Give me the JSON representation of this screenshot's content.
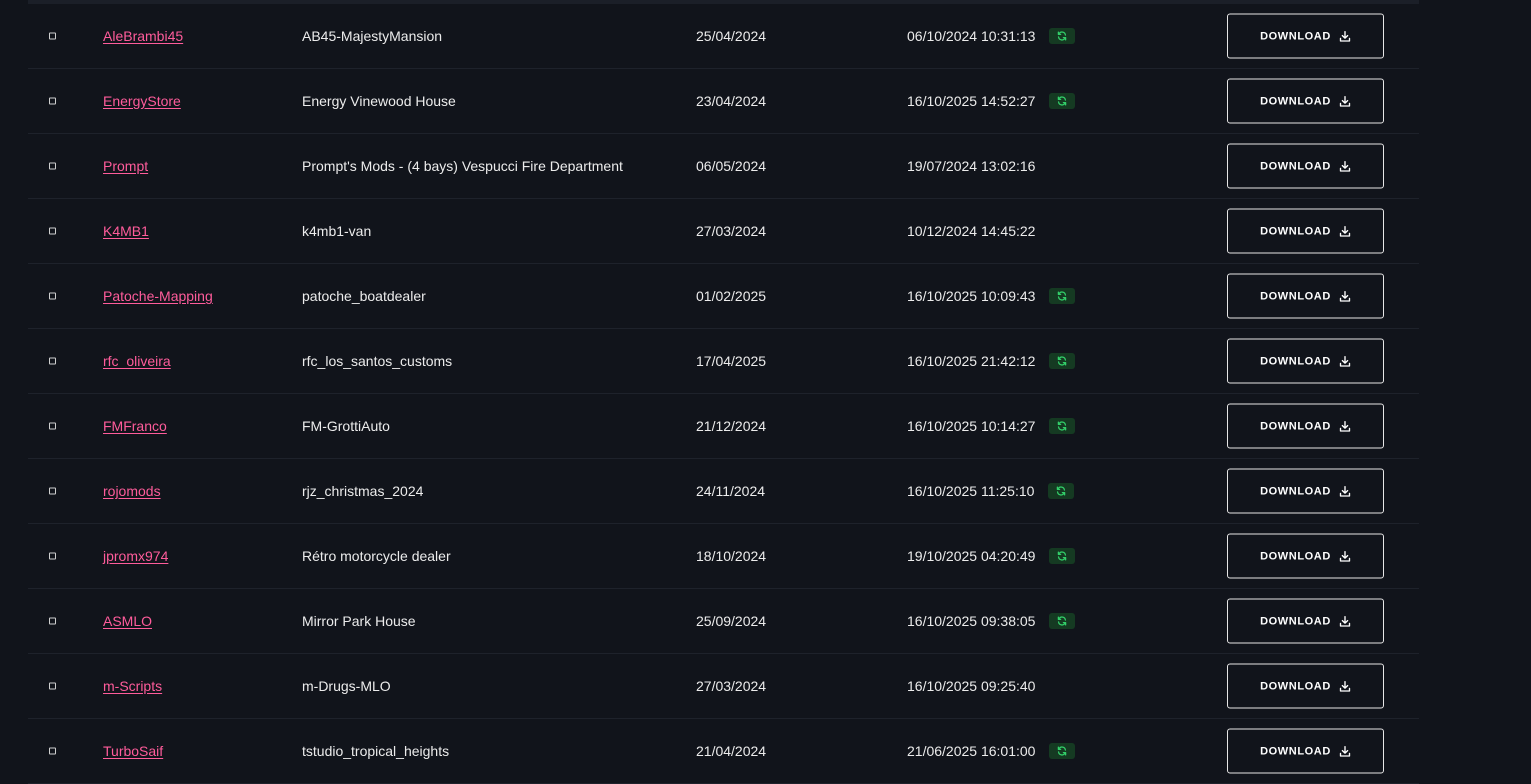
{
  "colors": {
    "background": "#11141b",
    "author_link": "#ff5c9b",
    "sync_badge_bg": "#153a22",
    "sync_icon": "#33d06a"
  },
  "icons": {
    "checkbox": "checkbox-icon",
    "sync": "sync-icon",
    "download": "download-icon"
  },
  "download_label": "DOWNLOAD",
  "rows": [
    {
      "author": "AleBrambi45",
      "name": "AB45-MajestyMansion",
      "created": "25/04/2024",
      "updated": "06/10/2024 10:31:13",
      "sync": true
    },
    {
      "author": "EnergyStore",
      "name": "Energy Vinewood House",
      "created": "23/04/2024",
      "updated": "16/10/2025 14:52:27",
      "sync": true
    },
    {
      "author": "Prompt",
      "name": "Prompt's Mods - (4 bays) Vespucci Fire Department",
      "created": "06/05/2024",
      "updated": "19/07/2024 13:02:16",
      "sync": false
    },
    {
      "author": "K4MB1",
      "name": "k4mb1-van",
      "created": "27/03/2024",
      "updated": "10/12/2024 14:45:22",
      "sync": false
    },
    {
      "author": "Patoche-Mapping",
      "name": "patoche_boatdealer",
      "created": "01/02/2025",
      "updated": "16/10/2025 10:09:43",
      "sync": true
    },
    {
      "author": "rfc_oliveira",
      "name": "rfc_los_santos_customs",
      "created": "17/04/2025",
      "updated": "16/10/2025 21:42:12",
      "sync": true
    },
    {
      "author": "FMFranco",
      "name": "FM-GrottiAuto",
      "created": "21/12/2024",
      "updated": "16/10/2025 10:14:27",
      "sync": true
    },
    {
      "author": "rojomods",
      "name": "rjz_christmas_2024",
      "created": "24/11/2024",
      "updated": "16/10/2025 11:25:10",
      "sync": true
    },
    {
      "author": "jpromx974",
      "name": "Rétro motorcycle dealer",
      "created": "18/10/2024",
      "updated": "19/10/2025 04:20:49",
      "sync": true
    },
    {
      "author": "ASMLO",
      "name": "Mirror Park House",
      "created": "25/09/2024",
      "updated": "16/10/2025 09:38:05",
      "sync": true
    },
    {
      "author": "m-Scripts",
      "name": "m-Drugs-MLO",
      "created": "27/03/2024",
      "updated": "16/10/2025 09:25:40",
      "sync": false
    },
    {
      "author": "TurboSaif",
      "name": "tstudio_tropical_heights",
      "created": "21/04/2024",
      "updated": "21/06/2025 16:01:00",
      "sync": true
    }
  ]
}
